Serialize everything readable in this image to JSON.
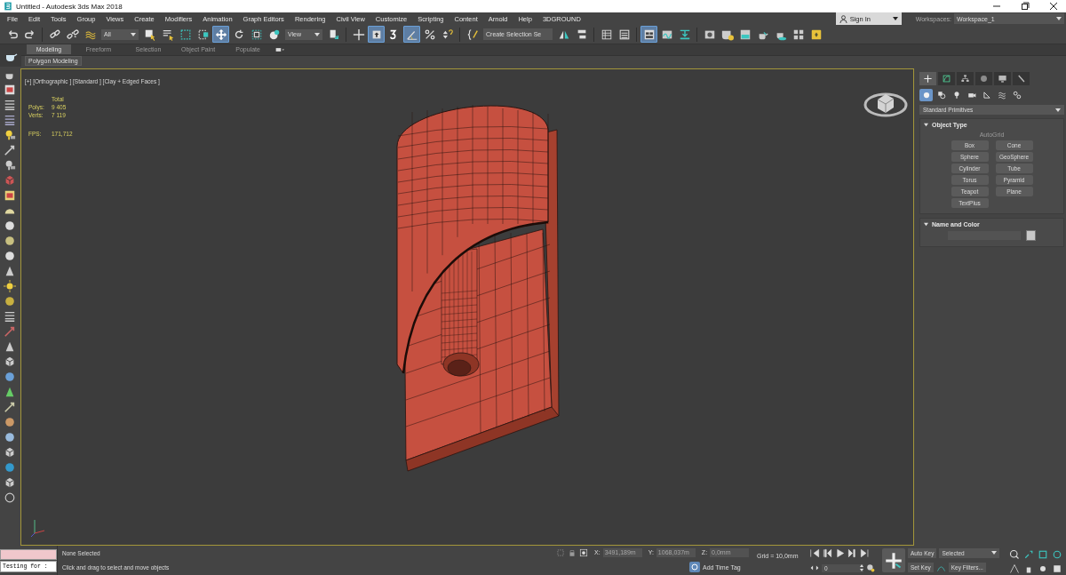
{
  "window": {
    "title": "Untitled - Autodesk 3ds Max 2018"
  },
  "menu": [
    "File",
    "Edit",
    "Tools",
    "Group",
    "Views",
    "Create",
    "Modifiers",
    "Animation",
    "Graph Editors",
    "Rendering",
    "Civil View",
    "Customize",
    "Scripting",
    "Content",
    "Arnold",
    "Help",
    "3DGROUND"
  ],
  "account": {
    "label": "Sign In"
  },
  "workspaces": {
    "label": "Workspaces:",
    "value": "Workspace_1"
  },
  "toolbar": [
    [
      {
        "kind": "undo",
        "selected": false
      },
      {
        "kind": "redo",
        "selected": false
      }
    ],
    [
      {
        "kind": "link",
        "selected": false
      },
      {
        "kind": "unlink",
        "selected": false
      },
      {
        "kind": "bind",
        "selected": false
      },
      {
        "kind": "dropdown",
        "value": "All"
      },
      {
        "kind": "select",
        "selected": false
      },
      {
        "kind": "select_name",
        "selected": false
      },
      {
        "kind": "region",
        "selected": false
      },
      {
        "kind": "crossing",
        "selected": false
      },
      {
        "kind": "move",
        "selected": true
      },
      {
        "kind": "rotate",
        "selected": false
      },
      {
        "kind": "scale",
        "selected": false
      },
      {
        "kind": "placement",
        "selected": false
      },
      {
        "kind": "dropdown",
        "value": "View"
      },
      {
        "kind": "pivot",
        "selected": false
      }
    ],
    [
      {
        "kind": "manipulate",
        "selected": false
      },
      {
        "kind": "keyboard",
        "selected": true
      },
      {
        "kind": "snap",
        "selected": false
      },
      {
        "kind": "angle_snap",
        "selected": true
      },
      {
        "kind": "percent_snap",
        "selected": false
      },
      {
        "kind": "spinner_snap",
        "selected": false
      }
    ],
    [
      {
        "kind": "named_sets",
        "selected": false
      },
      {
        "kind": "field",
        "value": "Create Selection Se"
      },
      {
        "kind": "mirror",
        "selected": false
      },
      {
        "kind": "align",
        "selected": false
      }
    ],
    [
      {
        "kind": "scene_explorer",
        "selected": false
      },
      {
        "kind": "layer_explorer",
        "selected": false
      }
    ],
    [
      {
        "kind": "ribbon",
        "selected": true
      },
      {
        "kind": "curve_editor",
        "selected": false
      },
      {
        "kind": "schematic",
        "selected": false
      }
    ],
    [
      {
        "kind": "material_editor",
        "selected": false
      },
      {
        "kind": "render_setup",
        "selected": false
      },
      {
        "kind": "rendered_frame",
        "selected": false
      },
      {
        "kind": "render",
        "selected": false
      },
      {
        "kind": "render_iterative",
        "selected": false
      },
      {
        "kind": "viewport_layout",
        "selected": false
      },
      {
        "kind": "yellow_tab",
        "selected": false
      }
    ]
  ],
  "ribbon": {
    "tabs": [
      {
        "label": "Modeling",
        "selected": true
      },
      {
        "label": "Freeform",
        "selected": false
      },
      {
        "label": "Selection",
        "selected": false
      },
      {
        "label": "Object Paint",
        "selected": false
      },
      {
        "label": "Populate",
        "selected": false
      }
    ],
    "panel": "Polygon Modeling"
  },
  "viewport": {
    "label": "[+] [Orthographic ] [Standard ] [Clay + Edged Faces ]",
    "stats_header": "Total",
    "stats": [
      {
        "label": "Polys:",
        "value": "9 405"
      },
      {
        "label": "Verts:",
        "value": "7 119"
      }
    ],
    "fps_label": "FPS:",
    "fps": "171,712"
  },
  "command_panel": {
    "tabs": [
      {
        "kind": "create",
        "selected": true
      },
      {
        "kind": "modify",
        "selected": false
      },
      {
        "kind": "hierarchy",
        "selected": false
      },
      {
        "kind": "motion",
        "selected": false
      },
      {
        "kind": "display",
        "selected": false
      },
      {
        "kind": "utilities",
        "selected": false
      }
    ],
    "categories": [
      {
        "kind": "geometry",
        "selected": true
      },
      {
        "kind": "shapes",
        "selected": false
      },
      {
        "kind": "lights",
        "selected": false
      },
      {
        "kind": "cameras",
        "selected": false
      },
      {
        "kind": "helpers",
        "selected": false
      },
      {
        "kind": "spacewarps",
        "selected": false
      },
      {
        "kind": "systems",
        "selected": false
      }
    ],
    "dropdown": "Standard Primitives",
    "object_type": {
      "title": "Object Type",
      "expanded": true,
      "autogrid": {
        "label": "AutoGrid",
        "disabled": true
      },
      "buttons": [
        "Box",
        "Cone",
        "Sphere",
        "GeoSphere",
        "Cylinder",
        "Tube",
        "Torus",
        "Pyramid",
        "Teapot",
        "Plane",
        "TextPlus"
      ]
    },
    "name_and_color": {
      "title": "Name and Color",
      "expanded": true
    }
  },
  "status": {
    "listener": "Testing for :",
    "selection": "None Selected",
    "prompt": "Click and drag to select and move objects",
    "coords": [
      {
        "label": "X:",
        "value": "3491,189m"
      },
      {
        "label": "Y:",
        "value": "1068,037m"
      },
      {
        "label": "Z:",
        "value": "0,0mm"
      }
    ],
    "grid": "Grid = 10,0mm",
    "time_tag": "Add Time Tag",
    "frame": "0",
    "auto_key": "Auto Key",
    "key_mode": "Selected",
    "set_key": "Set Key",
    "key_filters": "Key Filters..."
  }
}
